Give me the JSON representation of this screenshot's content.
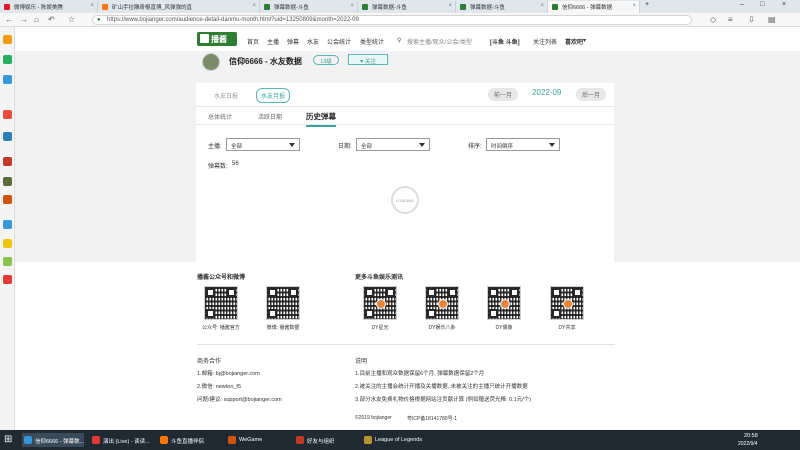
{
  "browser": {
    "tabs": [
      {
        "label": "微博娱乐 - 陈娱美腾",
        "color": "#e6162d"
      },
      {
        "label": "矿山手拉雕奇棍直博_风弹弹的直",
        "color": "#ff7700"
      },
      {
        "label": "弹幕数据-斗鱼",
        "color": "#2e7d32"
      },
      {
        "label": "弹幕数据-斗鱼",
        "color": "#2e7d32"
      },
      {
        "label": "弹幕数据-斗鱼",
        "color": "#2e7d32"
      },
      {
        "label": "信仰6666 - 弹幕数据",
        "color": "#2e7d32"
      }
    ],
    "url": "https://www.doseeing.com/audience-detail-danmu-month.html?uid=13250809&month=2022-09",
    "url_display": "https://www.bojianger.com/audience-detail-danmu-month.html?uid=13250809&month=2022-09"
  },
  "site": {
    "logo": "播酱",
    "menu": [
      "首页",
      "主播",
      "弹幕",
      "水友",
      "公会统计",
      "类型统计"
    ],
    "search_placeholder": "搜索主播/观众/公会/类型",
    "platform": "[斗鱼 斗鱼]",
    "follow_list": "关注列表",
    "user": "喜欢吧"
  },
  "profile": {
    "name": "信仰6666 - 水友数据",
    "level": "13级",
    "follow": "关注"
  },
  "card": {
    "type_tabs": [
      "水友日报",
      "水友月报"
    ],
    "prev_month": "前一月",
    "month": "2022-09",
    "next_month": "后一月",
    "tabs": [
      "总体统计",
      "活跃日期",
      "历史弹幕"
    ],
    "filters": [
      {
        "label": "主播:",
        "value": "全部"
      },
      {
        "label": "日期:",
        "value": "全部"
      },
      {
        "label": "排序:",
        "value": "时间倒序"
      }
    ],
    "danmu_count_label": "弹幕数:",
    "danmu_count": "56",
    "loading": "LOADING"
  },
  "footer": {
    "left_title": "播酱公众号和微博",
    "left_qrs": [
      "公众号: 播酱官方",
      "微博: 播酱数据"
    ],
    "right_title": "更多斗鱼娱乐测讯",
    "right_qrs": [
      "DY星光",
      "DY娱乐八卦",
      "DY偶像",
      "DY共享"
    ],
    "biz_title": "商务合作",
    "biz": [
      "1.邮箱: bj@bojianger.com",
      "2.微信: newton_f5",
      "问题/建议: support@bojianger.com"
    ],
    "note_title": "说明",
    "notes": [
      "1.目前主播和观众数据保留6个月, 弹幕数据保留2个月",
      "2.被关注的主播会统计开播及关播数据, 未被关注的主播只统计开播数据",
      "3.部分水友免费礼物价格根据网站注贡献计算 (例如赠送荧光棒: 0.1元/个)"
    ],
    "copyright": "©2019 bojianger",
    "icp": "粤ICP备18141780号-1"
  },
  "taskbar": {
    "items": [
      "信仰6666 - 弹幕数...",
      "演出 (Live) - 读读...",
      "斗鱼直播伴侣",
      "WeGame",
      "好友与组织",
      "League of Legends"
    ],
    "time": "20:58",
    "date": "2022/9/4"
  }
}
